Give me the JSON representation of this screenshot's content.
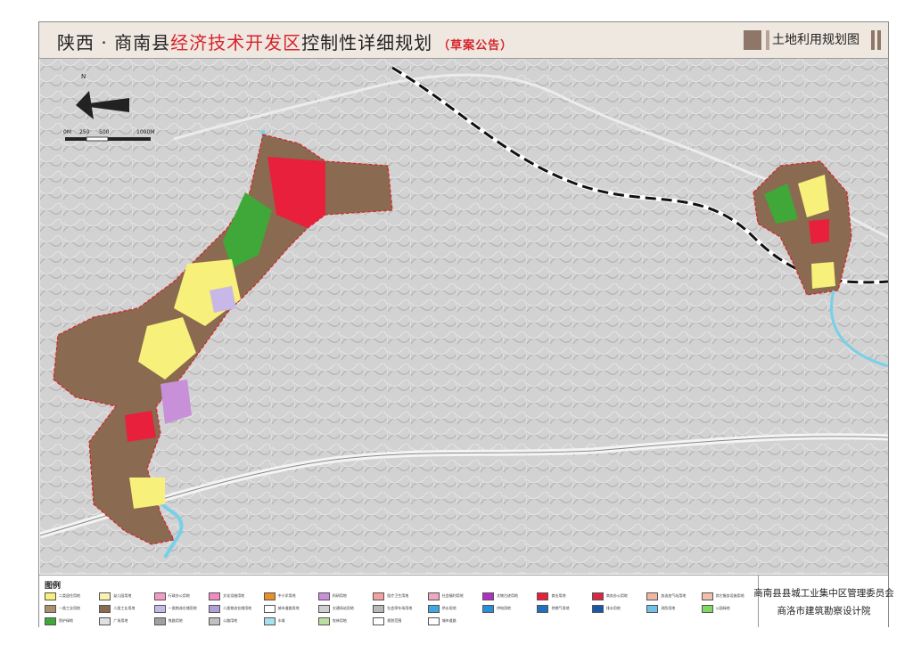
{
  "header": {
    "title_prefix": "陕西 · 商南县",
    "title_highlight": "经济技术开发区",
    "title_suffix": "控制性详细规划",
    "title_note": "（草案公告）",
    "map_title": "土地利用规划图"
  },
  "map": {
    "north_label": "N",
    "scale_labels": [
      "0M",
      "250",
      "500",
      "1000M"
    ]
  },
  "legend": {
    "title": "图例",
    "items": [
      {
        "label": "二类居住用地",
        "color": "#f7f07a"
      },
      {
        "label": "幼儿园用地",
        "color": "#f9f2b0"
      },
      {
        "label": "行政办公用地",
        "color": "#f59ac3"
      },
      {
        "label": "文化设施用地",
        "color": "#f28ac0"
      },
      {
        "label": "中小学用地",
        "color": "#e8902a"
      },
      {
        "label": "科研用地",
        "color": "#c890d8"
      },
      {
        "label": "医疗卫生用地",
        "color": "#f4a0a0"
      },
      {
        "label": "社会福利用地",
        "color": "#f0a8c0"
      },
      {
        "label": "文物古迹用地",
        "color": "#b030c0"
      },
      {
        "label": "商业用地",
        "color": "#e8203c"
      },
      {
        "label": "商务办公用地",
        "color": "#d82848"
      },
      {
        "label": "加油加气站用地",
        "color": "#f0b8a0"
      },
      {
        "label": "其它服务设施用地",
        "color": "#f0c0a8"
      },
      {
        "label": "一类工业用地",
        "color": "#a89070"
      },
      {
        "label": "二类工业用地",
        "color": "#8a6a50"
      },
      {
        "label": "一类物流仓储用地",
        "color": "#c8b8e8"
      },
      {
        "label": "二类物流仓储用地",
        "color": "#b0a0d8"
      },
      {
        "label": "城市道路用地",
        "color": "#ffffff"
      },
      {
        "label": "交通场站用地",
        "color": "#d0d0d0"
      },
      {
        "label": "社会停车场用地",
        "color": "#b8b8b8"
      },
      {
        "label": "供水用地",
        "color": "#40a8e0"
      },
      {
        "label": "供电用地",
        "color": "#2890d8"
      },
      {
        "label": "供燃气用地",
        "color": "#2070c0"
      },
      {
        "label": "排水用地",
        "color": "#1858a8"
      },
      {
        "label": "消防用地",
        "color": "#70c0e8"
      },
      {
        "label": "公园绿地",
        "color": "#80d860"
      },
      {
        "label": "防护绿地",
        "color": "#40a838"
      },
      {
        "label": "广场用地",
        "color": "#e0e0e0"
      },
      {
        "label": "铁路用地",
        "color": "#a0a0a0"
      },
      {
        "label": "公路用地",
        "color": "#c0c0c0"
      },
      {
        "label": "水域",
        "color": "#a8e0f0"
      },
      {
        "label": "农林用地",
        "color": "#b8e0a0"
      },
      {
        "label": "规划范围",
        "color": "#ffffff"
      },
      {
        "label": "城市道路",
        "color": "#ffffff"
      }
    ]
  },
  "org": {
    "line1": "商南县县城工业集中区管理委员会",
    "line2": "商洛市建筑勘察设计院"
  }
}
